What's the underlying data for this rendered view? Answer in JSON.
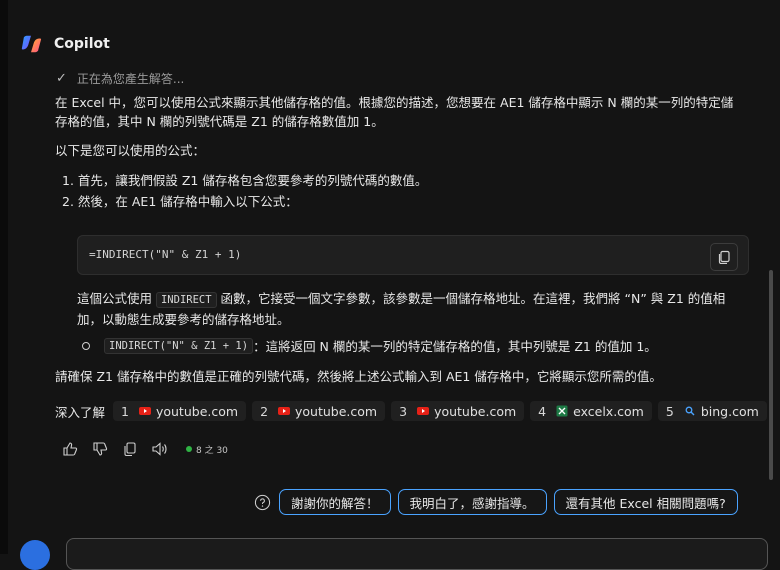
{
  "app": {
    "title": "Copilot"
  },
  "status": {
    "text": "正在為您產生解答..."
  },
  "answer": {
    "intro": "在 Excel 中，您可以使用公式來顯示其他儲存格的值。根據您的描述，您想要在 AE1 儲存格中顯示 N 欄的某一列的特定儲存格的值，其中 N 欄的列號代碼是 Z1 的儲存格數值加 1。",
    "intro_line1": "在 Excel 中，您可以使用公式來顯示其他儲存格的值。根據您的描述，您想要在 AE1 儲存格中顯示 N 欄的某一列的特定儲",
    "intro_line2": "存格的值，其中 N 欄的列號代碼是 Z1 的儲存格數值加 1。",
    "formula_intro": "以下是您可以使用的公式：",
    "steps": [
      "1. 首先，讓我們假設 Z1 儲存格包含您要參考的列號代碼的數值。",
      "2. 然後，在 AE1 儲存格中輸入以下公式："
    ],
    "code": "=INDIRECT(\"N\" & Z1 + 1)",
    "explain_pre": "這個公式使用 ",
    "explain_code": "INDIRECT",
    "explain_post_line1": " 函數，它接受一個文字參數，該參數是一個儲存格地址。在這裡，我們將 “N” 與 Z1 的值相",
    "explain_line2": "加，以動態生成要參考的儲存格地址。",
    "bullet_code": "INDIRECT(\"N\" & Z1 + 1)",
    "bullet_text": "：這將返回 N 欄的某一列的特定儲存格的值，其中列號是 Z1 的值加 1。",
    "closing": "請確保 Z1 儲存格中的數值是正確的列號代碼，然後將上述公式輸入到 AE1 儲存格中，它將顯示您所需的值。"
  },
  "learn_more": {
    "label": "深入了解",
    "sources": [
      {
        "num": "1",
        "site": "youtube.com",
        "icon": "youtube-icon"
      },
      {
        "num": "2",
        "site": "youtube.com",
        "icon": "youtube-icon"
      },
      {
        "num": "3",
        "site": "youtube.com",
        "icon": "youtube-icon"
      },
      {
        "num": "4",
        "site": "excelx.com",
        "icon": "excel-icon"
      },
      {
        "num": "5",
        "site": "bing.com",
        "icon": "bing-search-icon"
      }
    ]
  },
  "counter": {
    "text": "8 之 30"
  },
  "suggestions": [
    "謝謝你的解答！",
    "我明白了，感謝指導。",
    "還有其他 Excel 相關問題嗎?"
  ],
  "colors": {
    "accent": "#4aa3ff",
    "background": "#141414",
    "youtube": "#e62117",
    "excel": "#1d7a45",
    "status_green": "#2fb344"
  }
}
